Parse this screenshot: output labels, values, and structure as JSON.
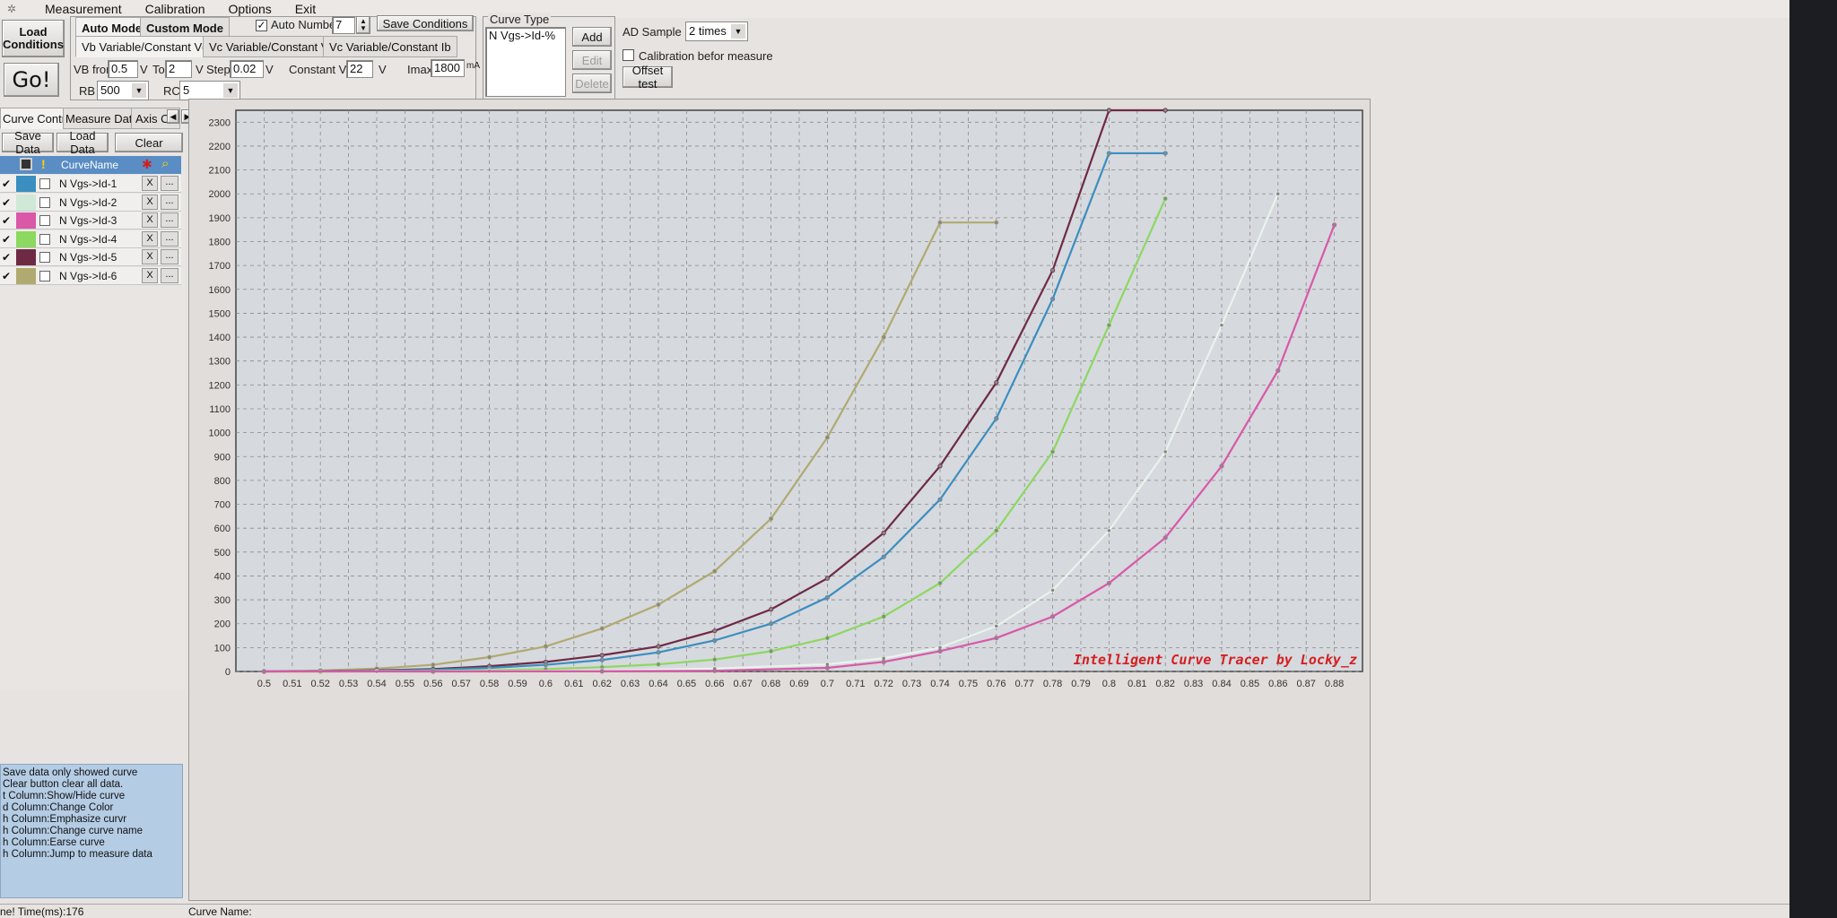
{
  "menu": [
    "Measurement",
    "Calibration",
    "Options",
    "Exit"
  ],
  "left_buttons": {
    "load_conditions": "Load Conditions",
    "go": "Go!"
  },
  "mode_tabs": [
    "Auto Mode",
    "Custom Mode"
  ],
  "sub_tabs": [
    "Vb Variable/Constant Vce",
    "Vc Variable/Constant Vb",
    "Vc Variable/Constant Ib"
  ],
  "auto_number": {
    "label": "Auto Number",
    "value": "7",
    "checked": true
  },
  "save_conditions": "Save Conditions",
  "params": {
    "vb_from_label": "VB from",
    "vb_from": "0.5",
    "v1": "V",
    "to_label": "To",
    "to": "2",
    "v2": "V",
    "step_label": "Step",
    "step": "0.02",
    "v3": "V",
    "vce_label": "Constant Vce",
    "vce": "22",
    "v4": "V",
    "imax_label": "Imax",
    "imax": "1800",
    "imax_unit": "mA",
    "rb_label": "RB",
    "rb": "500",
    "rc_label": "RC",
    "rc": "5"
  },
  "curve_type": {
    "title": "Curve Type",
    "item": "N Vgs->Id-%",
    "add": "Add",
    "edit": "Edit",
    "delete": "Delete"
  },
  "ad_sample": {
    "label": "AD Sample",
    "value": "2 times"
  },
  "calibration": {
    "label": "Calibration befor measure",
    "checked": false
  },
  "offset_test": "Offset test",
  "side_tabs": [
    "Curve Control",
    "Measure Data",
    "Axis Co"
  ],
  "side_buttons": {
    "save": "Save Data",
    "load": "Load Data",
    "clear": "Clear"
  },
  "grid_header": {
    "name": "CurveName"
  },
  "curves": [
    {
      "name": "N Vgs->Id-1",
      "color": "#3b8ec0",
      "visible": true
    },
    {
      "name": "N Vgs->Id-2",
      "color": "#cfe8d8",
      "visible": true
    },
    {
      "name": "N Vgs->Id-3",
      "color": "#d958a8",
      "visible": true
    },
    {
      "name": "N Vgs->Id-4",
      "color": "#8cd860",
      "visible": true
    },
    {
      "name": "N Vgs->Id-5",
      "color": "#6e2a44",
      "visible": true
    },
    {
      "name": "N Vgs->Id-6",
      "color": "#b0aa70",
      "visible": true
    }
  ],
  "help_lines": [
    "Save data only showed curve",
    "Clear button clear all data.",
    "t Column:Show/Hide curve",
    "d Column:Change Color",
    "h Column:Emphasize curvr",
    "h Column:Change curve name",
    "h Column:Earse curve",
    "h Column:Jump to measure data"
  ],
  "status": {
    "left": "ne!  Time(ms):176",
    "curve_name": "Curve Name:"
  },
  "chart_data": {
    "type": "line",
    "xlim": [
      0.49,
      0.89
    ],
    "ylim": [
      0,
      2350
    ],
    "x_ticks": [
      0.5,
      0.51,
      0.52,
      0.53,
      0.54,
      0.55,
      0.56,
      0.57,
      0.58,
      0.59,
      0.6,
      0.61,
      0.62,
      0.63,
      0.64,
      0.65,
      0.66,
      0.67,
      0.68,
      0.69,
      0.7,
      0.71,
      0.72,
      0.73,
      0.74,
      0.75,
      0.76,
      0.77,
      0.78,
      0.79,
      0.8,
      0.81,
      0.82,
      0.83,
      0.84,
      0.85,
      0.86,
      0.87,
      0.88
    ],
    "y_ticks": [
      0,
      100,
      200,
      300,
      400,
      500,
      600,
      700,
      800,
      900,
      1000,
      1100,
      1200,
      1300,
      1400,
      1500,
      1600,
      1700,
      1800,
      1900,
      2000,
      2100,
      2200,
      2300
    ],
    "annotation": "Intelligent Curve Tracer by Locky_z",
    "series": [
      {
        "name": "N Vgs->Id-6",
        "color": "#b0aa70",
        "x": [
          0.5,
          0.52,
          0.54,
          0.56,
          0.58,
          0.6,
          0.62,
          0.64,
          0.66,
          0.68,
          0.7,
          0.72,
          0.74,
          0.76
        ],
        "y": [
          1,
          4,
          12,
          28,
          60,
          105,
          180,
          280,
          420,
          640,
          980,
          1400,
          1880,
          1880
        ]
      },
      {
        "name": "N Vgs->Id-5",
        "color": "#6e2a44",
        "x": [
          0.5,
          0.52,
          0.54,
          0.56,
          0.58,
          0.6,
          0.62,
          0.64,
          0.66,
          0.68,
          0.7,
          0.72,
          0.74,
          0.76,
          0.78,
          0.8,
          0.82
        ],
        "y": [
          0,
          2,
          5,
          10,
          22,
          40,
          68,
          105,
          170,
          260,
          390,
          580,
          860,
          1210,
          1680,
          2350,
          2350
        ]
      },
      {
        "name": "N Vgs->Id-1",
        "color": "#3b8ec0",
        "x": [
          0.5,
          0.52,
          0.54,
          0.56,
          0.58,
          0.6,
          0.62,
          0.64,
          0.66,
          0.68,
          0.7,
          0.72,
          0.74,
          0.76,
          0.78,
          0.8,
          0.82
        ],
        "y": [
          0,
          1,
          3,
          7,
          15,
          28,
          48,
          80,
          130,
          200,
          310,
          480,
          720,
          1060,
          1560,
          2170,
          2170
        ]
      },
      {
        "name": "N Vgs->Id-4",
        "color": "#8cd860",
        "x": [
          0.5,
          0.52,
          0.54,
          0.56,
          0.58,
          0.6,
          0.62,
          0.64,
          0.66,
          0.68,
          0.7,
          0.72,
          0.74,
          0.76,
          0.78,
          0.8,
          0.82
        ],
        "y": [
          0,
          0,
          1,
          2,
          5,
          10,
          18,
          30,
          50,
          85,
          140,
          230,
          370,
          590,
          920,
          1450,
          1980
        ]
      },
      {
        "name": "N Vgs->Id-2",
        "color": "#e8f4ec",
        "x": [
          0.5,
          0.54,
          0.58,
          0.62,
          0.66,
          0.7,
          0.72,
          0.74,
          0.76,
          0.78,
          0.8,
          0.82,
          0.84,
          0.86
        ],
        "y": [
          0,
          0,
          1,
          4,
          12,
          30,
          55,
          100,
          190,
          340,
          590,
          920,
          1450,
          2000
        ]
      },
      {
        "name": "N Vgs->Id-3",
        "color": "#d958a8",
        "x": [
          0.5,
          0.56,
          0.62,
          0.66,
          0.7,
          0.72,
          0.74,
          0.76,
          0.78,
          0.8,
          0.82,
          0.84,
          0.86,
          0.88
        ],
        "y": [
          0,
          0,
          1,
          3,
          15,
          40,
          85,
          140,
          230,
          370,
          560,
          860,
          1260,
          1870
        ]
      }
    ]
  }
}
